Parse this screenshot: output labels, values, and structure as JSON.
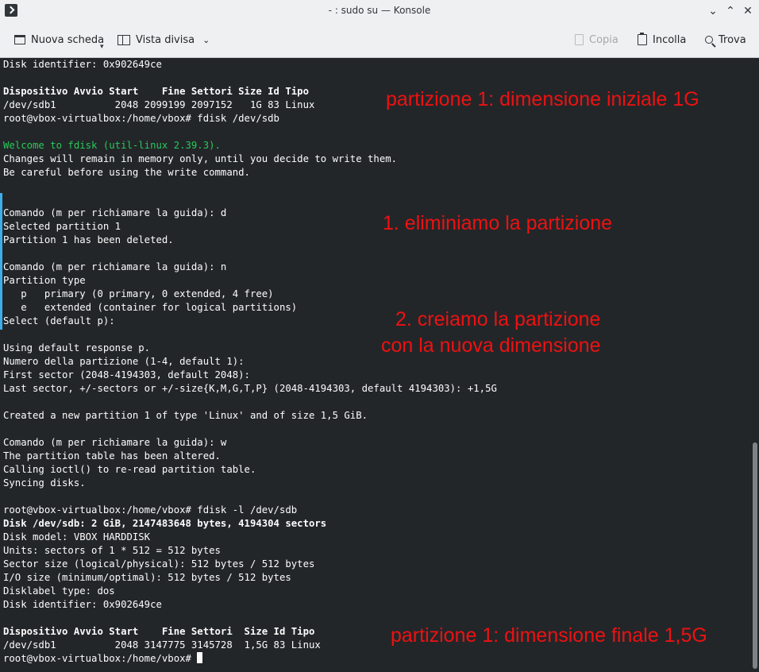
{
  "window": {
    "title": "- : sudo su — Konsole",
    "minimize_glyph": "⌄",
    "maximize_glyph": "⌃",
    "close_glyph": "✕"
  },
  "toolbar": {
    "new_tab": "Nuova scheda",
    "split_view": "Vista divisa",
    "split_chevron": "⌄",
    "copy": "Copia",
    "paste": "Incolla",
    "find": "Trova"
  },
  "terminal": {
    "lines": [
      {
        "text": "Disk identifier: 0x902649ce",
        "style": ""
      },
      {
        "text": "",
        "style": ""
      },
      {
        "text": "Dispositivo Avvio Start    Fine Settori Size Id Tipo",
        "style": "bold"
      },
      {
        "text": "/dev/sdb1          2048 2099199 2097152   1G 83 Linux",
        "style": ""
      },
      {
        "text": "root@vbox-virtualbox:/home/vbox# fdisk /dev/sdb",
        "style": ""
      },
      {
        "text": "",
        "style": ""
      },
      {
        "text": "Welcome to fdisk (util-linux 2.39.3).",
        "style": "green"
      },
      {
        "text": "Changes will remain in memory only, until you decide to write them.",
        "style": ""
      },
      {
        "text": "Be careful before using the write command.",
        "style": ""
      },
      {
        "text": "",
        "style": ""
      },
      {
        "text": "",
        "style": ""
      },
      {
        "text": "Comando (m per richiamare la guida): d",
        "style": ""
      },
      {
        "text": "Selected partition 1",
        "style": ""
      },
      {
        "text": "Partition 1 has been deleted.",
        "style": ""
      },
      {
        "text": "",
        "style": ""
      },
      {
        "text": "Comando (m per richiamare la guida): n",
        "style": ""
      },
      {
        "text": "Partition type",
        "style": ""
      },
      {
        "text": "   p   primary (0 primary, 0 extended, 4 free)",
        "style": ""
      },
      {
        "text": "   e   extended (container for logical partitions)",
        "style": ""
      },
      {
        "text": "Select (default p):",
        "style": ""
      },
      {
        "text": "",
        "style": ""
      },
      {
        "text": "Using default response p.",
        "style": ""
      },
      {
        "text": "Numero della partizione (1-4, default 1):",
        "style": ""
      },
      {
        "text": "First sector (2048-4194303, default 2048):",
        "style": ""
      },
      {
        "text": "Last sector, +/-sectors or +/-size{K,M,G,T,P} (2048-4194303, default 4194303): +1,5G",
        "style": ""
      },
      {
        "text": "",
        "style": ""
      },
      {
        "text": "Created a new partition 1 of type 'Linux' and of size 1,5 GiB.",
        "style": ""
      },
      {
        "text": "",
        "style": ""
      },
      {
        "text": "Comando (m per richiamare la guida): w",
        "style": ""
      },
      {
        "text": "The partition table has been altered.",
        "style": ""
      },
      {
        "text": "Calling ioctl() to re-read partition table.",
        "style": ""
      },
      {
        "text": "Syncing disks.",
        "style": ""
      },
      {
        "text": "",
        "style": ""
      },
      {
        "text": "root@vbox-virtualbox:/home/vbox# fdisk -l /dev/sdb",
        "style": ""
      },
      {
        "text": "Disk /dev/sdb: 2 GiB, 2147483648 bytes, 4194304 sectors",
        "style": "bold"
      },
      {
        "text": "Disk model: VBOX HARDDISK",
        "style": ""
      },
      {
        "text": "Units: sectors of 1 * 512 = 512 bytes",
        "style": ""
      },
      {
        "text": "Sector size (logical/physical): 512 bytes / 512 bytes",
        "style": ""
      },
      {
        "text": "I/O size (minimum/optimal): 512 bytes / 512 bytes",
        "style": ""
      },
      {
        "text": "Disklabel type: dos",
        "style": ""
      },
      {
        "text": "Disk identifier: 0x902649ce",
        "style": ""
      },
      {
        "text": "",
        "style": ""
      },
      {
        "text": "Dispositivo Avvio Start    Fine Settori  Size Id Tipo",
        "style": "bold"
      },
      {
        "text": "/dev/sdb1          2048 3147775 3145728  1,5G 83 Linux",
        "style": ""
      }
    ],
    "prompt": "root@vbox-virtualbox:/home/vbox# "
  },
  "annotations": {
    "initial": "partizione 1: dimensione iniziale 1G",
    "step1": "1. eliminiamo la partizione",
    "step2_line1": "2. creiamo la partizione",
    "step2_line2": "con la nuova dimensione",
    "final": "partizione 1: dimensione finale 1,5G",
    "color": "#ee1111"
  },
  "colors": {
    "terminal_bg": "#232629",
    "terminal_fg": "#fcfcfc",
    "welcome_green": "#27c95a"
  }
}
